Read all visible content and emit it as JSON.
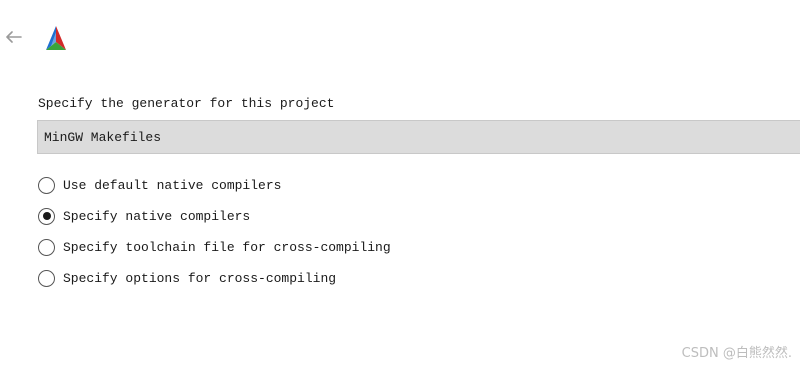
{
  "header": {
    "back_icon": "arrow-left-icon",
    "logo_icon": "cmake-logo-icon"
  },
  "generator": {
    "label": "Specify the generator for this project",
    "selected": "MinGW Makefiles"
  },
  "compiler_options": [
    {
      "label": "Use default native compilers",
      "checked": false
    },
    {
      "label": "Specify native compilers",
      "checked": true
    },
    {
      "label": "Specify toolchain file for cross-compiling",
      "checked": false
    },
    {
      "label": "Specify options for cross-compiling",
      "checked": false
    }
  ],
  "watermark": "CSDN @白熊然然."
}
